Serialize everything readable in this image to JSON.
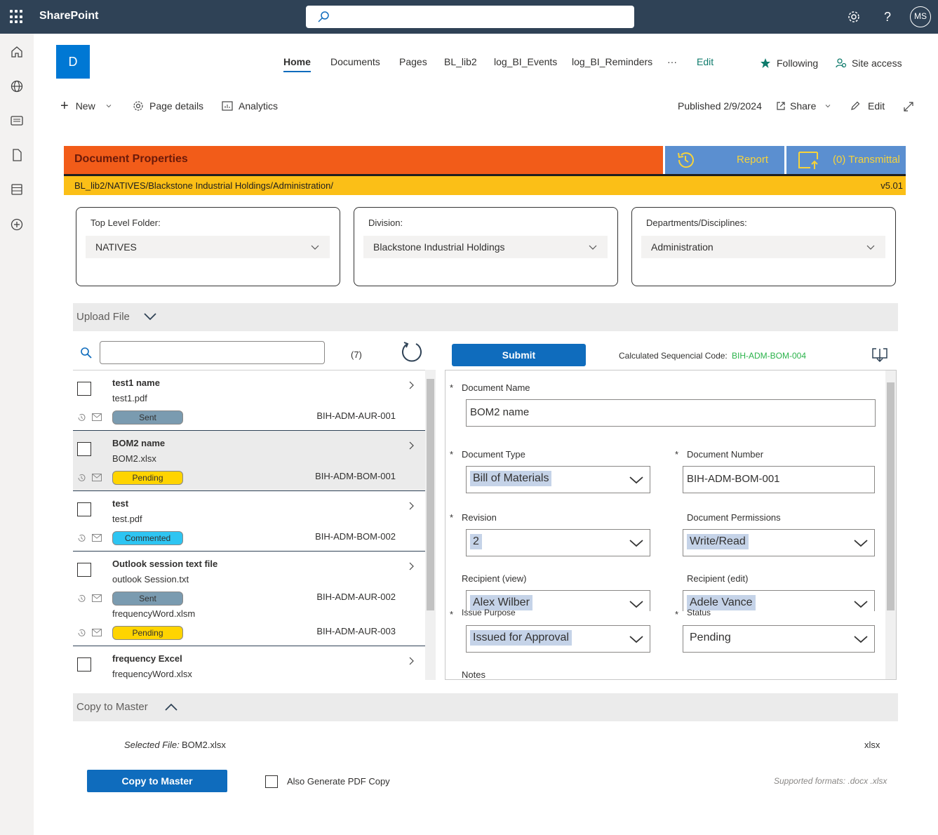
{
  "app": {
    "brand": "SharePoint",
    "avatar_initials": "MS",
    "site_letter": "D"
  },
  "nav": {
    "home": "Home",
    "documents": "Documents",
    "pages": "Pages",
    "bl_lib2": "BL_lib2",
    "events": "log_BI_Events",
    "reminders": "log_BI_Reminders",
    "more": "···",
    "edit": "Edit",
    "following": "Following",
    "site_access": "Site access"
  },
  "commands": {
    "new": "New",
    "page_details": "Page details",
    "analytics": "Analytics",
    "published": "Published 2/9/2024",
    "share": "Share",
    "edit": "Edit"
  },
  "banner": {
    "title": "Document Properties",
    "report": "Report",
    "transmittal": "(0) Transmittal",
    "path": "BL_lib2/NATIVES/Blackstone Industrial Holdings/Administration/",
    "version": "v5.01"
  },
  "folders": [
    {
      "label": "Top Level Folder:",
      "value": "NATIVES"
    },
    {
      "label": "Division:",
      "value": "Blackstone Industrial Holdings"
    },
    {
      "label": "Departments/Disciplines:",
      "value": "Administration"
    }
  ],
  "upload": {
    "title": "Upload File"
  },
  "list": {
    "count": "(7)",
    "items": [
      {
        "name": "test1 name",
        "file": "test1.pdf",
        "status": "Sent",
        "code": "BIH-ADM-AUR-001"
      },
      {
        "name": "BOM2 name",
        "file": "BOM2.xlsx",
        "status": "Pending",
        "code": "BIH-ADM-BOM-001"
      },
      {
        "name": "test",
        "file": "test.pdf",
        "status": "Commented",
        "code": "BIH-ADM-BOM-002"
      },
      {
        "name": "Outlook session text file",
        "file": "outlook Session.txt",
        "status": "Sent",
        "code": "BIH-ADM-AUR-002"
      },
      {
        "name": "",
        "file": "frequencyWord.xlsm",
        "status": "Pending",
        "code": "BIH-ADM-AUR-003"
      },
      {
        "name": "frequency Excel",
        "file": "frequencyWord.xlsx",
        "status": "",
        "code": ""
      }
    ]
  },
  "status_colors": {
    "Sent": "#7a9bb0",
    "Pending": "#ffd400",
    "Commented": "#2ec5f2"
  },
  "form": {
    "submit": "Submit",
    "seq_label": "Calculated Sequencial Code:",
    "seq_value": "BIH-ADM-BOM-004",
    "doc_name_label": "Document Name",
    "doc_name_value": "BOM2 name",
    "doc_type_label": "Document Type",
    "doc_type_value": "Bill of Materials",
    "doc_number_label": "Document Number",
    "doc_number_value": "BIH-ADM-BOM-001",
    "revision_label": "Revision",
    "revision_value": "2",
    "permissions_label": "Document Permissions",
    "permissions_value": "Write/Read",
    "recipient_view_label": "Recipient (view)",
    "recipient_view_value": "Alex Wilber",
    "recipient_edit_label": "Recipient (edit)",
    "recipient_edit_value": "Adele Vance",
    "issue_label": "Issue Purpose",
    "issue_value": "Issued for Approval",
    "status_label": "Status",
    "status_value": "Pending",
    "notes_label": "Notes",
    "required_mark": "*"
  },
  "copy": {
    "title": "Copy to Master",
    "selected_label": "Selected File:",
    "selected_value": "BOM2.xlsx",
    "ext": "xlsx",
    "button": "Copy to Master",
    "pdf_label": "Also Generate PDF Copy",
    "formats": "Supported formats: .docx .xlsx"
  }
}
